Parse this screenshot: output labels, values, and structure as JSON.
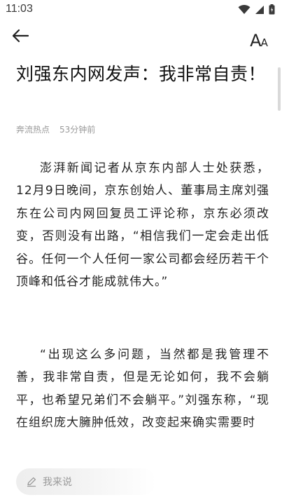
{
  "status_bar": {
    "time": "11:03",
    "icons": [
      "wifi-icon",
      "signal-icon",
      "battery-icon"
    ]
  },
  "app_bar": {
    "back_icon": "arrow-left-icon",
    "font_size_icon": "font-size-icon",
    "font_size_big": "A",
    "font_size_small": "A"
  },
  "article": {
    "title": "刘强东内网发声：我非常自责！",
    "source": "奔流热点",
    "time_ago": "53分钟前",
    "paragraphs": [
      "澎湃新闻记者从京东内部人士处获悉，12月9日晚间，京东创始人、董事局主席刘强东在公司内网回复员工评论称，京东必须改变，否则没有出路，“相信我们一定会走出低谷。任何一个人任何一家公司都会经历若干个顶峰和低谷才能成就伟大。”",
      "“出现这么多问题，当然都是我管理不善，我非常自责，但是无论如何，我不会躺平，也希望兄弟们不会躺平。”刘强东称，“现在组织庞大臃肿低效，改变起来确实需要时"
    ]
  },
  "comment_bar": {
    "icon": "pencil-icon",
    "placeholder": "我来说"
  }
}
